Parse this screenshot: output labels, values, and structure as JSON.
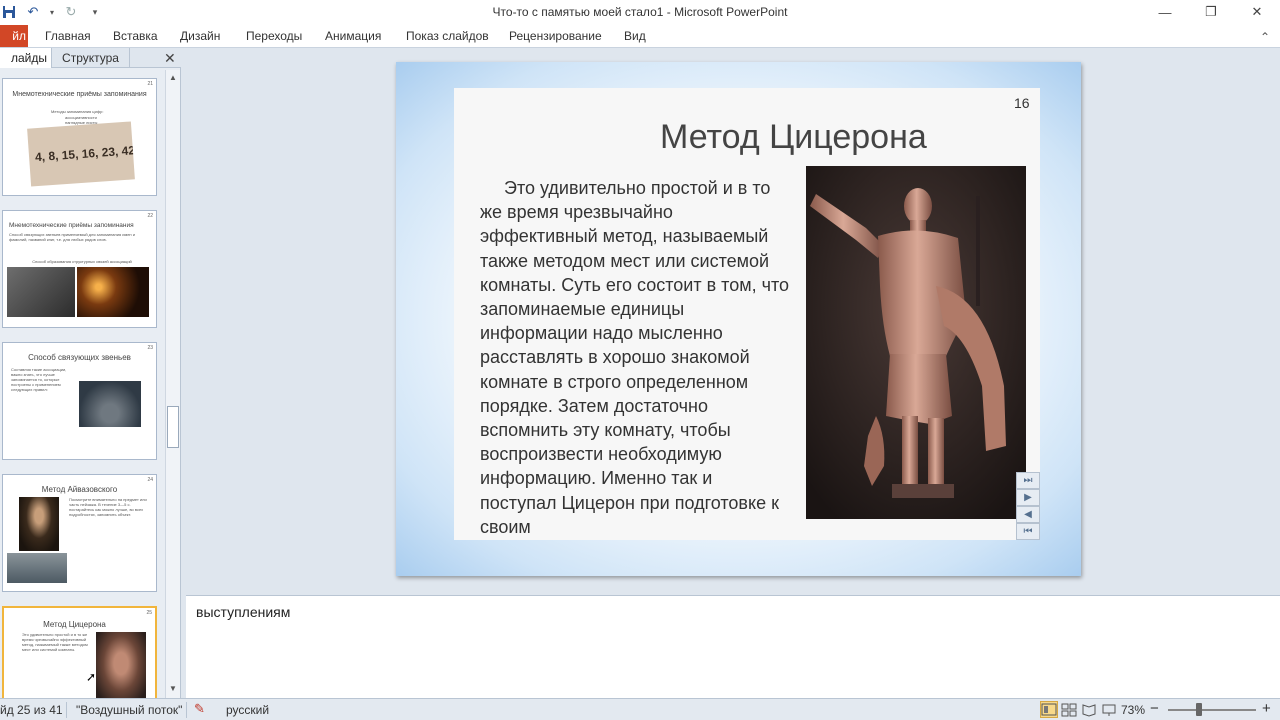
{
  "window": {
    "title": "Что-то с памятью моей стало1  -  Microsoft PowerPoint",
    "controls": {
      "minimize": "—",
      "restore": "❐",
      "close": "✕"
    }
  },
  "ribbon": {
    "file_tab": "йл",
    "tabs": [
      "Главная",
      "Вставка",
      "Дизайн",
      "Переходы",
      "Анимация",
      "Показ слайдов",
      "Рецензирование",
      "Вид"
    ]
  },
  "left_pane": {
    "tab_slides": "лайды",
    "tab_outline": "Структура",
    "thumbnails": [
      {
        "title": "Мнемотехнические приёмы запоминания",
        "subtitle": "Методы запоминания цифр:",
        "bullets": [
          "ассоциативности",
          "наглядные листы"
        ],
        "number_strip": "4, 8, 15, 16, 23, 42"
      },
      {
        "title": "Мнемотехнические приёмы запоминания",
        "text": "Способ связующих звеньев применяемый для запоминания имен и фамилий, названий книг, т.е. для любых рядов слов.",
        "caption": "Способ образования структурных связей ассоциаций"
      },
      {
        "title": "Способ связующих звеньев",
        "text": "Составляя такие ассоциации, важно знать, что лучше запоминается то, которые построены с применением следующих правил:"
      },
      {
        "title": "Метод Айвазовского",
        "text": "Посмотрите внимательно на предмет или часть пейзажа. В течение 3—5 с. постарайтесь как можно лучше, во всех подробностях, запомнить объект."
      },
      {
        "title": "Метод Цицерона",
        "text": "Это удивительно простой и в то же время чрезвычайно эффективный метод, называемый также методом мест или системой комнаты."
      }
    ]
  },
  "slide": {
    "number": "16",
    "title": "Метод Цицерона",
    "body": "Это удивительно простой и в то же время чрезвычайно эффективный метод, называемый также методом мест или системой комнаты. Суть его состоит в том, что запоминаемые единицы информации надо мысленно расставлять в хорошо знакомой комнате в строго определенном порядке. Затем достаточно вспомнить эту комнату, чтобы воспроизвести необходимую информацию. Именно так и поступал Цицерон при подготовке к своим",
    "nav_buttons": [
      "⏭",
      "▶",
      "◀",
      "⏮"
    ]
  },
  "notes": {
    "text": "выступлениям"
  },
  "statusbar": {
    "slide_counter": "йд 25 из 41",
    "theme": "\"Воздушный поток\"",
    "language": "русский",
    "zoom": "73%",
    "zoom_minus": "−",
    "zoom_plus": "+"
  }
}
